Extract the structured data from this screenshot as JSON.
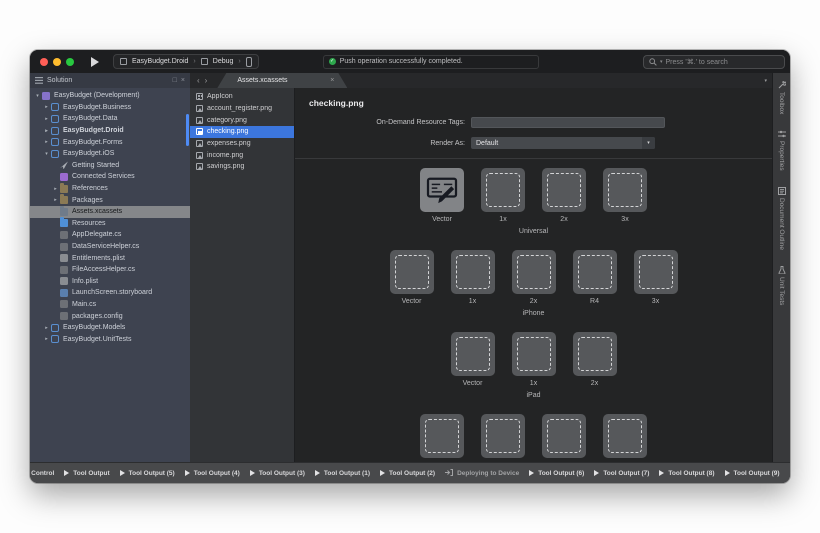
{
  "colors": {
    "selection_blue": "#3c76dd",
    "status_green": "#2ea84d",
    "traffic_red": "#ff5f57",
    "traffic_yellow": "#febc2e",
    "traffic_green": "#28c840",
    "solution_pad_bg": "#3e4350",
    "editor_bg": "#232425"
  },
  "toolbar": {
    "project": "EasyBudget.Droid",
    "configuration": "Debug",
    "status_message": "Push operation successfully completed.",
    "search_text": "Press '⌘.' to search"
  },
  "solution_pad": {
    "title": "Solution",
    "tree": [
      {
        "label": "EasyBudget (Development)",
        "indent": 0,
        "arrow": "down",
        "icon": "solution"
      },
      {
        "label": "EasyBudget.Business",
        "indent": 1,
        "arrow": "right",
        "icon": "project"
      },
      {
        "label": "EasyBudget.Data",
        "indent": 1,
        "arrow": "right",
        "icon": "project"
      },
      {
        "label": "EasyBudget.Droid",
        "indent": 1,
        "arrow": "right",
        "icon": "project",
        "bold": true
      },
      {
        "label": "EasyBudget.Forms",
        "indent": 1,
        "arrow": "right",
        "icon": "project"
      },
      {
        "label": "EasyBudget.iOS",
        "indent": 1,
        "arrow": "down",
        "icon": "project"
      },
      {
        "label": "Getting Started",
        "indent": 2,
        "arrow": "",
        "icon": "getting-started"
      },
      {
        "label": "Connected Services",
        "indent": 2,
        "arrow": "",
        "icon": "connected-services"
      },
      {
        "label": "References",
        "indent": 2,
        "arrow": "right",
        "icon": "references-folder"
      },
      {
        "label": "Packages",
        "indent": 2,
        "arrow": "right",
        "icon": "packages-folder"
      },
      {
        "label": "Assets.xcassets",
        "indent": 2,
        "arrow": "",
        "icon": "assets-folder",
        "selected": true
      },
      {
        "label": "Resources",
        "indent": 2,
        "arrow": "",
        "icon": "folder"
      },
      {
        "label": "AppDelegate.cs",
        "indent": 2,
        "arrow": "",
        "icon": "csharp-file"
      },
      {
        "label": "DataServiceHelper.cs",
        "indent": 2,
        "arrow": "",
        "icon": "csharp-file"
      },
      {
        "label": "Entitlements.plist",
        "indent": 2,
        "arrow": "",
        "icon": "plist-file"
      },
      {
        "label": "FileAccessHelper.cs",
        "indent": 2,
        "arrow": "",
        "icon": "csharp-file"
      },
      {
        "label": "Info.plist",
        "indent": 2,
        "arrow": "",
        "icon": "plist-file"
      },
      {
        "label": "LaunchScreen.storyboard",
        "indent": 2,
        "arrow": "",
        "icon": "storyboard-file"
      },
      {
        "label": "Main.cs",
        "indent": 2,
        "arrow": "",
        "icon": "csharp-file"
      },
      {
        "label": "packages.config",
        "indent": 2,
        "arrow": "",
        "icon": "config-file"
      },
      {
        "label": "EasyBudget.Models",
        "indent": 1,
        "arrow": "right",
        "icon": "project"
      },
      {
        "label": "EasyBudget.UnitTests",
        "indent": 1,
        "arrow": "right",
        "icon": "project"
      }
    ]
  },
  "tabs": {
    "back": "‹",
    "forward": "›",
    "active": "Assets.xcassets",
    "close": "×",
    "overflow": "▾"
  },
  "file_list": {
    "items": [
      {
        "label": "AppIcon",
        "icon": "appicon"
      },
      {
        "label": "account_register.png",
        "icon": "image"
      },
      {
        "label": "category.png",
        "icon": "image"
      },
      {
        "label": "checking.png",
        "icon": "image",
        "selected": true
      },
      {
        "label": "expenses.png",
        "icon": "image"
      },
      {
        "label": "income.png",
        "icon": "image"
      },
      {
        "label": "savings.png",
        "icon": "image"
      }
    ]
  },
  "editor": {
    "title": "checking.png",
    "odr_label": "On-Demand Resource Tags:",
    "odr_value": "",
    "render_as_label": "Render As:",
    "render_as_value": "Default",
    "well_groups": [
      {
        "name": "Universal",
        "wells": [
          {
            "label": "Vector",
            "filled": true
          },
          {
            "label": "1x"
          },
          {
            "label": "2x"
          },
          {
            "label": "3x"
          }
        ]
      },
      {
        "name": "iPhone",
        "wells": [
          {
            "label": "Vector"
          },
          {
            "label": "1x"
          },
          {
            "label": "2x"
          },
          {
            "label": "R4"
          },
          {
            "label": "3x"
          }
        ]
      },
      {
        "name": "iPad",
        "wells": [
          {
            "label": "Vector"
          },
          {
            "label": "1x"
          },
          {
            "label": "2x"
          }
        ]
      },
      {
        "name": "",
        "wells": [
          {},
          {},
          {},
          {}
        ]
      }
    ]
  },
  "right_rail": {
    "items": [
      {
        "label": "Toolbox",
        "icon": "toolbox"
      },
      {
        "label": "Properties",
        "icon": "properties"
      },
      {
        "label": "Document Outline",
        "icon": "document-outline"
      },
      {
        "label": "Unit Tests",
        "icon": "unit-tests"
      }
    ]
  },
  "bottom_bar": {
    "items": [
      {
        "label": "sion Control",
        "icon": ""
      },
      {
        "label": "Tool Output",
        "icon": "play"
      },
      {
        "label": "Tool Output (5)",
        "icon": "play"
      },
      {
        "label": "Tool Output (4)",
        "icon": "play"
      },
      {
        "label": "Tool Output (3)",
        "icon": "play"
      },
      {
        "label": "Tool Output (1)",
        "icon": "play"
      },
      {
        "label": "Tool Output (2)",
        "icon": "play"
      },
      {
        "label": "Deploying to Device",
        "icon": "deploy",
        "dim": true
      },
      {
        "label": "Tool Output (6)",
        "icon": "play"
      },
      {
        "label": "Tool Output (7)",
        "icon": "play"
      },
      {
        "label": "Tool Output (8)",
        "icon": "play"
      },
      {
        "label": "Tool Output (9)",
        "icon": "play"
      }
    ]
  }
}
